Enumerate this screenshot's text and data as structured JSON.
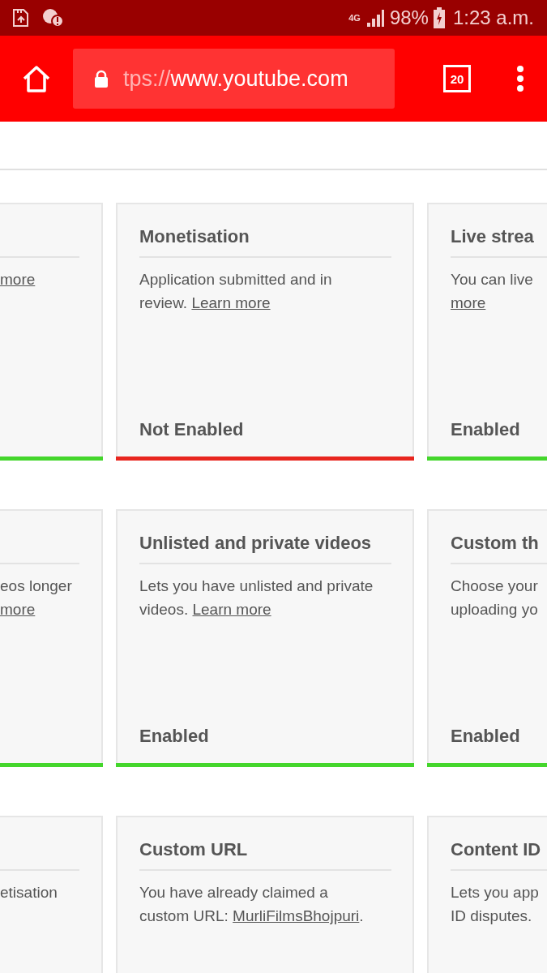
{
  "status_bar": {
    "network": "4G",
    "battery": "98%",
    "time": "1:23 a.m."
  },
  "browser": {
    "url_faded": "tps://",
    "url": "www.youtube.com",
    "tab_count": "20"
  },
  "rows": [
    {
      "cards": [
        {
          "description": {
            "link": "more"
          },
          "enabled": true
        },
        {
          "title": "Monetisation",
          "description": {
            "text": "Application submitted and in\nreview. ",
            "link": "Learn more"
          },
          "status": "Not Enabled",
          "enabled": false
        },
        {
          "title": "Live strea",
          "description": {
            "text": "You can live\n",
            "link": "more"
          },
          "status": "Enabled",
          "enabled": true
        }
      ]
    },
    {
      "cards": [
        {
          "description": {
            "text": "eos longer\n",
            "link": "more"
          },
          "enabled": true
        },
        {
          "title": "Unlisted and private videos",
          "description": {
            "text": "Lets you have unlisted and private\nvideos. ",
            "link": "Learn more"
          },
          "status": "Enabled",
          "enabled": true
        },
        {
          "title": "Custom th",
          "description": {
            "text": "Choose your\nuploading yo"
          },
          "status": "Enabled",
          "enabled": true
        }
      ]
    },
    {
      "cards": [
        {
          "description": {
            "text": "etisation"
          }
        },
        {
          "title": "Custom URL",
          "description": {
            "text": "You have already claimed a\ncustom URL: ",
            "link": "MurliFilmsBhojpuri",
            "suffix": "."
          }
        },
        {
          "title": "Content ID",
          "description": {
            "text": "Lets you app\nID disputes."
          }
        }
      ]
    }
  ]
}
